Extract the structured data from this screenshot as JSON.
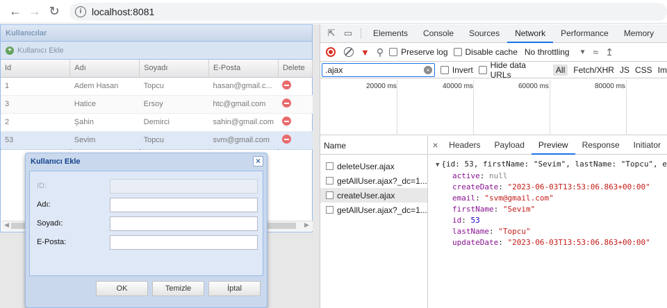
{
  "browser": {
    "url": "localhost:8081",
    "back_icon": "arrow-left-icon",
    "forward_icon": "arrow-right-icon",
    "reload_icon": "reload-icon",
    "info_icon": "info-icon"
  },
  "app": {
    "panel_title": "Kullanıcılar",
    "add_button_label": "Kullanıcı Ekle",
    "columns": [
      "Id",
      "Adı",
      "Soyadı",
      "E-Posta",
      "Delete"
    ],
    "rows": [
      {
        "id": "1",
        "name": "Adem Hasan",
        "surname": "Topcu",
        "email": "hasan@gmail.c..."
      },
      {
        "id": "3",
        "name": "Hatice",
        "surname": "Ersoy",
        "email": "htc@gmail.com"
      },
      {
        "id": "2",
        "name": "Şahin",
        "surname": "Demirci",
        "email": "sahin@gmail.com"
      },
      {
        "id": "53",
        "name": "Sevim",
        "surname": "Topcu",
        "email": "svm@gmail.com"
      }
    ]
  },
  "dialog": {
    "title": "Kullanıcı Ekle",
    "fields": {
      "id_label": "ID:",
      "name_label": "Adı:",
      "surname_label": "Soyadı:",
      "email_label": "E-Posta:"
    },
    "buttons": {
      "ok": "OK",
      "clear": "Temizle",
      "cancel": "İptal"
    }
  },
  "devtools": {
    "tabs": [
      "Elements",
      "Console",
      "Sources",
      "Network",
      "Performance",
      "Memory"
    ],
    "active_tab": "Network",
    "toolbar": {
      "preserve_log": "Preserve log",
      "disable_cache": "Disable cache",
      "throttling": "No throttling"
    },
    "filter": {
      "value": ".ajax",
      "invert": "Invert",
      "hide_data_urls": "Hide data URLs",
      "types": [
        "All",
        "Fetch/XHR",
        "JS",
        "CSS",
        "Im"
      ]
    },
    "timeline_ticks": [
      "20000 ms",
      "40000 ms",
      "60000 ms",
      "80000 ms"
    ],
    "name_header": "Name",
    "requests": [
      "deleteUser.ajax",
      "getAllUser.ajax?_dc=1...",
      "createUser.ajax",
      "getAllUser.ajax?_dc=1..."
    ],
    "selected_request_index": 2,
    "detail_tabs": [
      "Headers",
      "Payload",
      "Preview",
      "Response",
      "Initiator"
    ],
    "active_detail_tab": "Preview",
    "preview": {
      "summary": "{id: 53, firstName: \"Sevim\", lastName: \"Topcu\", e",
      "lines": [
        {
          "key": "active",
          "value": "null",
          "kind": "null"
        },
        {
          "key": "createDate",
          "value": "\"2023-06-03T13:53:06.863+00:00\"",
          "kind": "str"
        },
        {
          "key": "email",
          "value": "\"svm@gmail.com\"",
          "kind": "str"
        },
        {
          "key": "firstName",
          "value": "\"Sevim\"",
          "kind": "str"
        },
        {
          "key": "id",
          "value": "53",
          "kind": "num"
        },
        {
          "key": "lastName",
          "value": "\"Topcu\"",
          "kind": "str"
        },
        {
          "key": "updateDate",
          "value": "\"2023-06-03T13:53:06.863+00:00\"",
          "kind": "str"
        }
      ]
    }
  }
}
